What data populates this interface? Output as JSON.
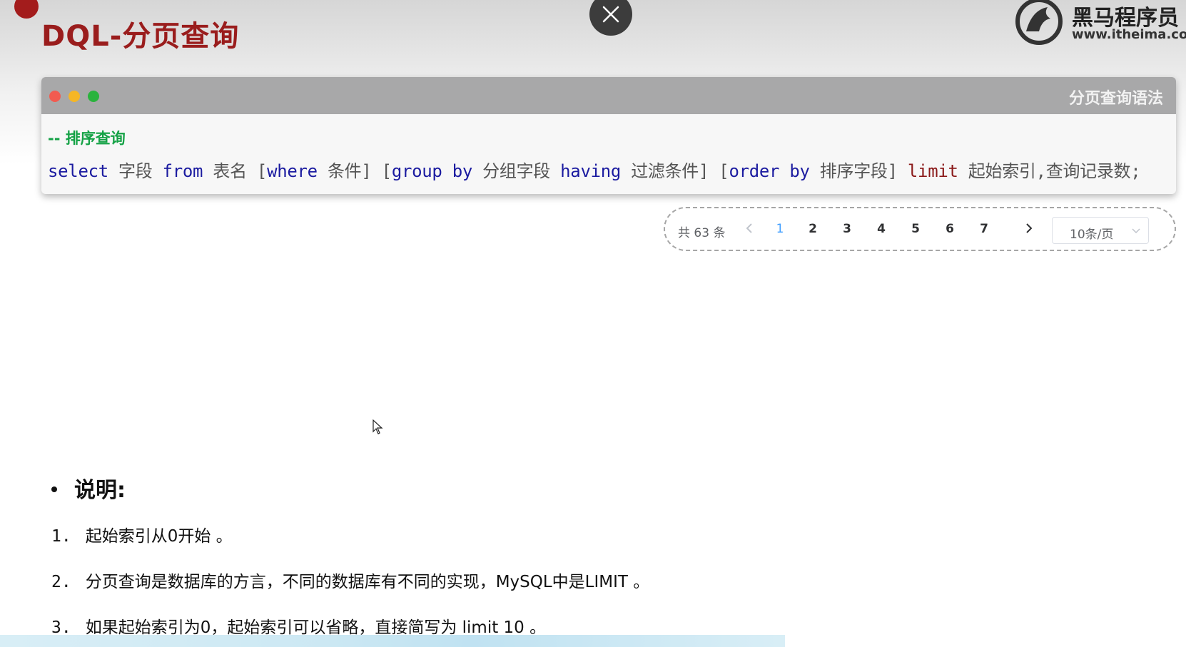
{
  "slide": {
    "title": "DQL-分页查询",
    "logo_name": "黑马程序员",
    "logo_url": "www.itheima.com"
  },
  "code_card": {
    "title": "分页查询语法",
    "comment": "-- 排序查询",
    "tokens": {
      "select": "select",
      "t1": " 字段 ",
      "from": "from",
      "t2": " 表名 [",
      "where": "where",
      "t3": " 条件] [",
      "group_by": "group by",
      "t4": " 分组字段 ",
      "having": "having",
      "t5": " 过滤条件] [",
      "order_by": "order by",
      "t6": " 排序字段] ",
      "limit": "limit",
      "t7": " 起始索引,查询记录数;"
    }
  },
  "pagination": {
    "total_label": "共 63 条",
    "pages": [
      "1",
      "2",
      "3",
      "4",
      "5",
      "6",
      "7"
    ],
    "active_page": "1",
    "page_size_label": "10条/页"
  },
  "notes": {
    "heading": "说明:",
    "items": [
      {
        "num": "1.",
        "text": "起始索引从0开始 。"
      },
      {
        "num": "2.",
        "text": "分页查询是数据库的方言，不同的数据库有不同的实现，MySQL中是LIMIT 。"
      },
      {
        "num": "3.",
        "text": "如果起始索引为0，起始索引可以省略，直接简写为 limit 10 。"
      }
    ]
  },
  "colors": {
    "title_red": "#9a1d1d",
    "keyword_blue": "#1b1ba0",
    "limit_red": "#8b1a1a",
    "comment_green": "#15a246",
    "active_page_blue": "#409eff"
  },
  "icons": [
    "close-icon",
    "prev-arrow-icon",
    "next-arrow-icon",
    "chevron-down-icon",
    "mouse-cursor-icon",
    "horse-logo-icon"
  ]
}
